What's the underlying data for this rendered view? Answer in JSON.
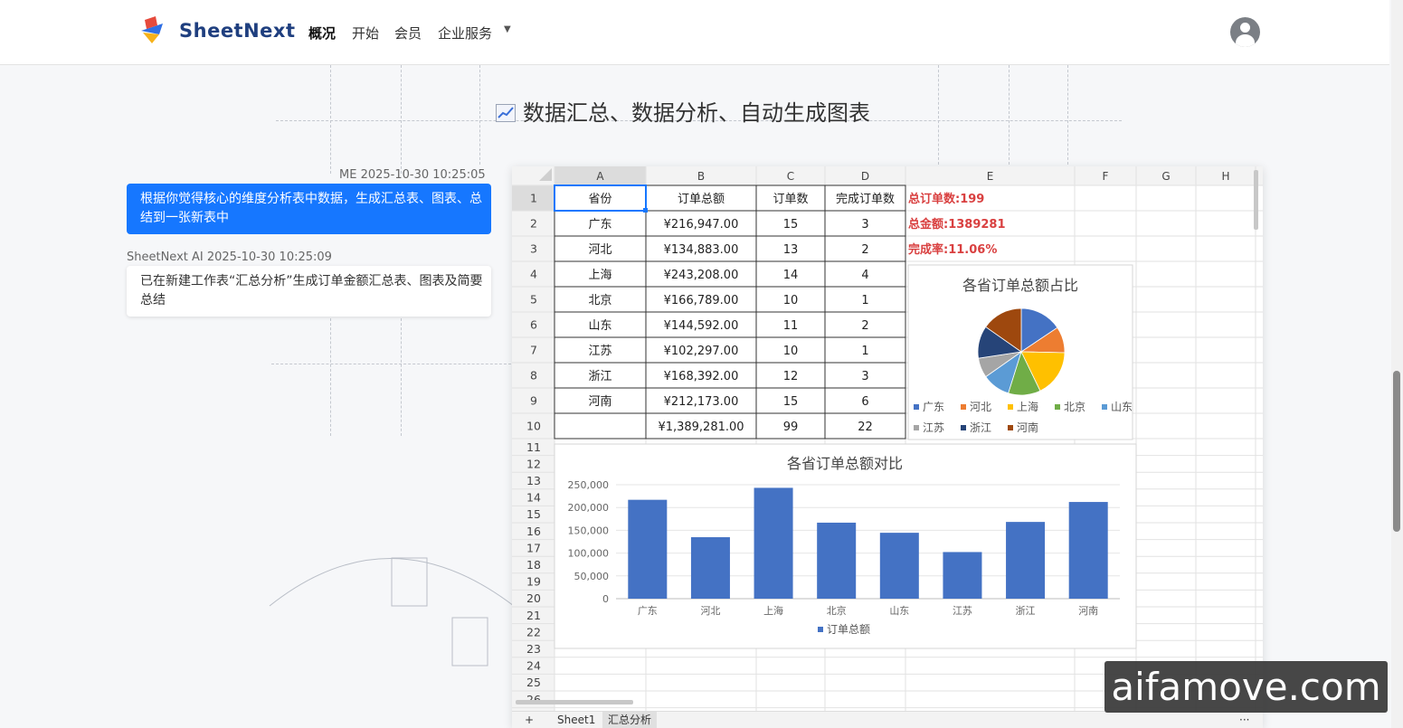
{
  "header": {
    "brand": "SheetNext",
    "nav": [
      "概况",
      "开始",
      "会员",
      "企业服务"
    ],
    "active_nav": "概况"
  },
  "headline": "数据汇总、数据分析、自动生成图表",
  "chat": {
    "me_meta": "ME 2025-10-30 10:25:05",
    "me_text": "根据你觉得核心的维度分析表中数据，生成汇总表、图表、总结到一张新表中",
    "ai_meta": "SheetNext AI 2025-10-30 10:25:09",
    "ai_text": "已在新建工作表“汇总分析”生成订单金额汇总表、图表及简要总结"
  },
  "sheet": {
    "columns": [
      "A",
      "B",
      "C",
      "D",
      "E",
      "F",
      "G",
      "H"
    ],
    "row_numbers": [
      "1",
      "2",
      "3",
      "4",
      "5",
      "6",
      "7",
      "8",
      "9",
      "10",
      "11",
      "12",
      "13",
      "14",
      "15",
      "16",
      "17",
      "18",
      "19",
      "20",
      "21",
      "22",
      "23",
      "24",
      "25",
      "26"
    ],
    "table_header": [
      "省份",
      "订单总额",
      "订单数",
      "完成订单数"
    ],
    "rows": [
      [
        "广东",
        "¥216,947.00",
        "15",
        "3"
      ],
      [
        "河北",
        "¥134,883.00",
        "13",
        "2"
      ],
      [
        "上海",
        "¥243,208.00",
        "14",
        "4"
      ],
      [
        "北京",
        "¥166,789.00",
        "10",
        "1"
      ],
      [
        "山东",
        "¥144,592.00",
        "11",
        "2"
      ],
      [
        "江苏",
        "¥102,297.00",
        "10",
        "1"
      ],
      [
        "浙江",
        "¥168,392.00",
        "12",
        "3"
      ],
      [
        "河南",
        "¥212,173.00",
        "15",
        "6"
      ]
    ],
    "total_row": [
      "",
      "¥1,389,281.00",
      "99",
      "22"
    ],
    "summary": [
      "总订单数:199",
      "总金额:1389281",
      "完成率:11.06%"
    ],
    "tabs": [
      "+",
      "Sheet1",
      "汇总分析",
      "···"
    ],
    "active_tab": "汇总分析"
  },
  "colors": {
    "primary": "#1677ff",
    "summary_red": "#d94040",
    "bar": "#4472c4",
    "pie": [
      "#4472c4",
      "#ed7d31",
      "#ffc000",
      "#70ad47",
      "#5b9bd5",
      "#a5a5a5",
      "#264478",
      "#9e480e"
    ]
  },
  "chart_data": [
    {
      "type": "pie",
      "title": "各省订单总额占比",
      "categories": [
        "广东",
        "河北",
        "上海",
        "北京",
        "山东",
        "江苏",
        "浙江",
        "河南"
      ],
      "values": [
        216947,
        134883,
        243208,
        166789,
        144592,
        102297,
        168392,
        212173
      ],
      "legend": "bottom"
    },
    {
      "type": "bar",
      "title": "各省订单总额对比",
      "categories": [
        "广东",
        "河北",
        "上海",
        "北京",
        "山东",
        "江苏",
        "浙江",
        "河南"
      ],
      "series": [
        {
          "name": "订单总额",
          "values": [
            216947,
            134883,
            243208,
            166789,
            144592,
            102297,
            168392,
            212173
          ]
        }
      ],
      "yticks": [
        "0",
        "50,000",
        "100,000",
        "150,000",
        "200,000",
        "250,000"
      ],
      "ylim": [
        0,
        250000
      ],
      "grid": true,
      "legend": "bottom"
    }
  ],
  "watermark": "aifamove.com"
}
